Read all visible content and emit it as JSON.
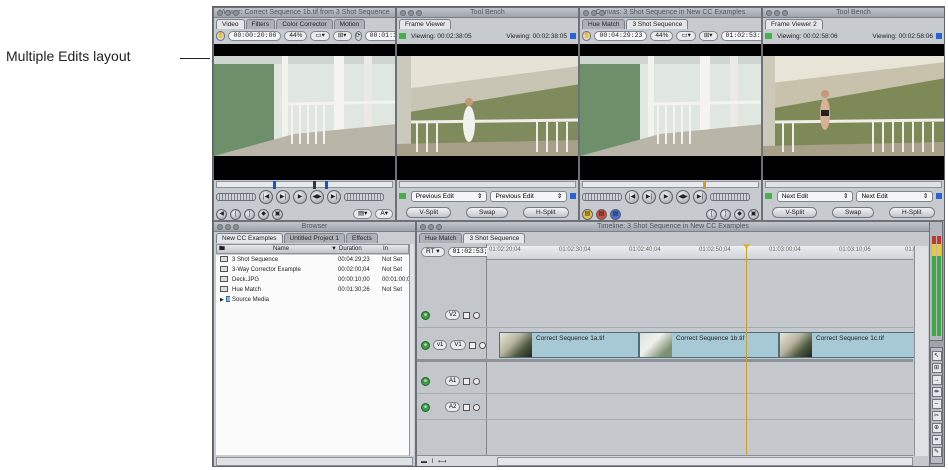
{
  "callout": {
    "text": "Multiple Edits layout"
  },
  "viewer": {
    "title": "Viewer: Correct Sequence 1b.tif from 3 Shot Sequence",
    "tabs": [
      "Video",
      "Filters",
      "Color Corrector",
      "Motion"
    ],
    "timecode_left": "00:00:20:00",
    "zoom": "44%",
    "timecode_right": "00:01:15:15"
  },
  "framev1": {
    "title": "Tool Bench",
    "tab": "Frame Viewer",
    "viewing_left": "Viewing: 00:02:38:05",
    "viewing_right": "Viewing: 00:02:38:05",
    "select_left": "Previous Edit",
    "select_right": "Previous Edit",
    "buttons": [
      "V-Split",
      "Swap",
      "H-Split"
    ]
  },
  "canvas": {
    "title": "Canvas: 3 Shot Sequence in New CC Examples",
    "tabs": [
      "Hue Match",
      "3 Shot Sequence"
    ],
    "timecode_left": "00:04:29:23",
    "zoom": "44%",
    "timecode_right": "01:02:53:21"
  },
  "framev2": {
    "title": "Tool Bench",
    "tab": "Frame Viewer 2",
    "viewing_left": "Viewing: 00:02:58:06",
    "viewing_right": "Viewing: 00:02:58:06",
    "select_left": "Next Edit",
    "select_right": "Next Edit",
    "buttons": [
      "V-Split",
      "Swap",
      "H-Split"
    ]
  },
  "browser": {
    "title": "Browser",
    "tabs": [
      "New CC Examples",
      "Untitled Project 1",
      "Effects"
    ],
    "columns": [
      "Name",
      "Duration",
      "In"
    ],
    "rows": [
      {
        "name": "3 Shot Sequence",
        "duration": "00:04:29;23",
        "in": "Not Set",
        "kind": "clip"
      },
      {
        "name": "3-Way Corrector Example",
        "duration": "00:02:00;04",
        "in": "Not Set",
        "kind": "clip"
      },
      {
        "name": "Deck.JPG",
        "duration": "00:00:10;00",
        "in": "00:01:00;00",
        "kind": "clip"
      },
      {
        "name": "Hue Match",
        "duration": "00:01:30;26",
        "in": "Not Set",
        "kind": "clip"
      },
      {
        "name": "Source Media",
        "duration": "",
        "in": "",
        "kind": "bin"
      }
    ]
  },
  "timeline": {
    "title": "Timeline: 3 Shot Sequence in New CC Examples",
    "tabs": [
      "Hue Match",
      "3 Shot Sequence"
    ],
    "rt_label": "RT",
    "timecode": "01:02:53;21",
    "ruler_ticks": [
      "01:02:20;04",
      "01:02:30;04",
      "01:02:40;04",
      "01:02:50;04",
      "01:03:00;04",
      "01:03:10;06",
      "01:0"
    ],
    "tracks": {
      "v2": "V2",
      "v1_src": "v1",
      "v1": "V1",
      "a1": "A1",
      "a2": "A2"
    },
    "clips": [
      "Correct Sequence 1a.tif",
      "Correct Sequence 1b.tif",
      "Correct Sequence 1c.tif"
    ]
  },
  "icons": {
    "transport": [
      "previous-edit-icon",
      "play-in-out-icon",
      "play-icon",
      "play-around-icon",
      "next-edit-icon"
    ],
    "tools": [
      "selection-icon",
      "edit-select-icon",
      "track-select-icon",
      "roll-icon",
      "slip-icon",
      "razor-icon",
      "zoom-icon",
      "crop-icon",
      "pen-icon"
    ]
  }
}
